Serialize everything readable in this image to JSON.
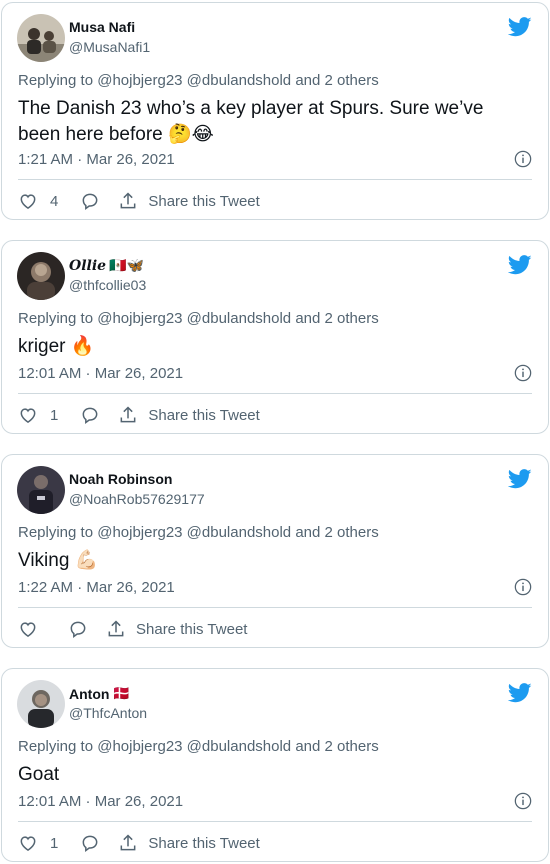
{
  "reply_prefix": "Replying to",
  "share_label": "Share this Tweet",
  "accent": "#1d9bf0",
  "tweets": [
    {
      "name": "Musa Nafi",
      "handle": "@MusaNafi1",
      "mentions": "@hojbjerg23 @dbulandshold",
      "others": "and 2 others",
      "text": "The Danish 23 who’s a key player at Spurs. Sure we’ve been here before 🤔😂",
      "timestamp": "1:21 AM · Mar 26, 2021",
      "likes": "4"
    },
    {
      "name": "Ollie",
      "name_emoji": "🇲🇽🦋",
      "handle": "@thfcollie03",
      "mentions": "@hojbjerg23 @dbulandshold",
      "others": "and 2 others",
      "text": "kriger 🔥",
      "timestamp": "12:01 AM · Mar 26, 2021",
      "likes": "1"
    },
    {
      "name": "Noah Robinson",
      "handle": "@NoahRob57629177",
      "mentions": "@hojbjerg23 @dbulandshold",
      "others": "and 2 others",
      "text": "Viking 💪🏻",
      "timestamp": "1:22 AM · Mar 26, 2021",
      "likes": ""
    },
    {
      "name": "Anton",
      "name_emoji": "🇩🇰",
      "handle": "@ThfcAnton",
      "mentions": "@hojbjerg23 @dbulandshold",
      "others": "and 2 others",
      "text": "Goat",
      "timestamp": "12:01 AM · Mar 26, 2021",
      "likes": "1"
    }
  ],
  "icons": {
    "brand": "twitter-bird-icon",
    "like": "heart-icon",
    "reply": "speech-bubble-icon",
    "share": "upload-arrow-icon",
    "info": "info-circle-icon"
  }
}
